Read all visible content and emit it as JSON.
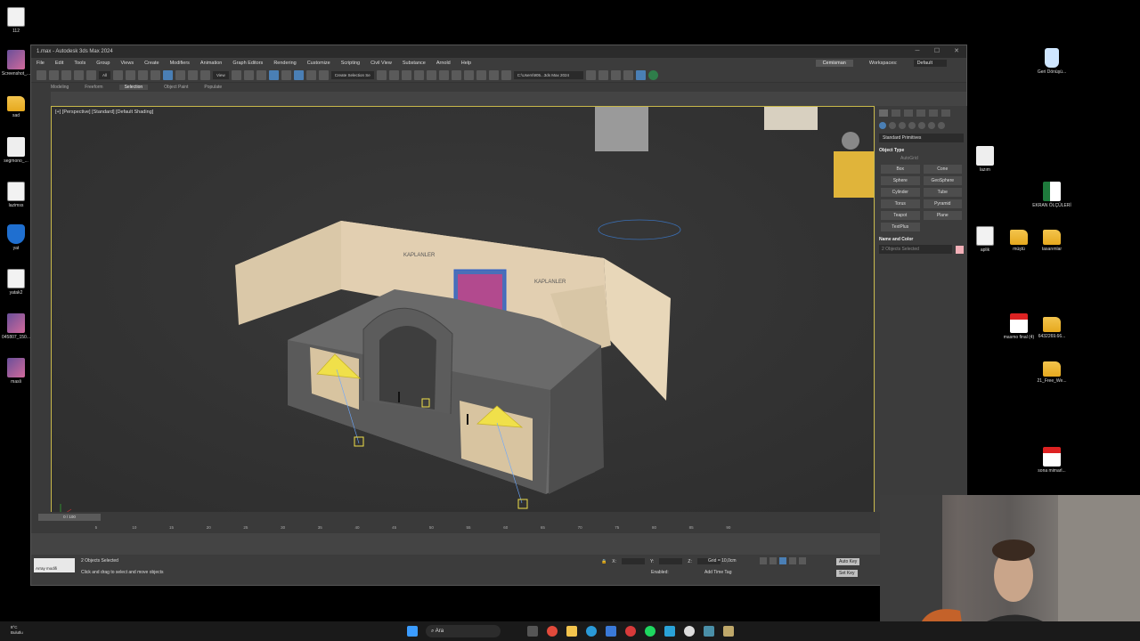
{
  "desktop": {
    "left_icons": [
      {
        "label": "112",
        "kind": "max"
      },
      {
        "label": "Screenshot_...",
        "kind": "img"
      },
      {
        "label": "sad",
        "kind": "folder"
      },
      {
        "label": "segmono_...",
        "kind": "file"
      },
      {
        "label": "lazimss",
        "kind": "max"
      },
      {
        "label": "yat",
        "kind": "shield"
      },
      {
        "label": "yatak2",
        "kind": "max"
      },
      {
        "label": "045807_150...",
        "kind": "img"
      },
      {
        "label": "masli",
        "kind": "img"
      }
    ],
    "right_icons": [
      {
        "label": "Geri Dönüşü...",
        "kind": "trash"
      },
      {
        "label": "lazım",
        "kind": "file"
      },
      {
        "label": "EKRAN ÖLÇÜLERİ",
        "kind": "xls"
      },
      {
        "label": "aplik",
        "kind": "max"
      },
      {
        "label": "müştü",
        "kind": "folder"
      },
      {
        "label": "tasarımlar",
        "kind": "folder"
      },
      {
        "label": "masmo final (4)",
        "kind": "pdf"
      },
      {
        "label": "6432269.66...",
        "kind": "folder"
      },
      {
        "label": "21_Free_We...",
        "kind": "folder"
      },
      {
        "label": "sona mimarl...",
        "kind": "pdf"
      }
    ]
  },
  "window": {
    "title": "1.max - Autodesk 3ds Max 2024",
    "menu": [
      "File",
      "Edit",
      "Tools",
      "Group",
      "Views",
      "Create",
      "Modifiers",
      "Animation",
      "Graph Editors",
      "Rendering",
      "Customize",
      "Scripting",
      "Civil View",
      "Substance",
      "Arnold",
      "Help"
    ],
    "user": "Cemisman",
    "workspaces_label": "Workspaces:",
    "workspace": "Default",
    "toolbar": {
      "filter": "All",
      "view": "View",
      "selection_set": "Create Selection Se",
      "path": "C:\\Users\\905...3ds Max 2024"
    },
    "ribbon": [
      "Modeling",
      "Freeform",
      "Selection",
      "Object Paint",
      "Populate"
    ],
    "ribbon_active": "Selection",
    "viewport_label": "[+] [Perspective] [Standard] [Default Shading]",
    "scene": {
      "sign1": "KAPLANLER",
      "sign2": "KAPLANLER"
    },
    "command_panel": {
      "dropdown": "Standard Primitives",
      "object_type": "Object Type",
      "autogrid": "AutoGrid",
      "buttons": [
        "Box",
        "Cone",
        "Sphere",
        "GeoSphere",
        "Cylinder",
        "Tube",
        "Torus",
        "Pyramid",
        "Teapot",
        "Plane",
        "TextPlus"
      ],
      "name_color": "Name and Color",
      "name_value": "2 Objects Selected",
      "swatch_color": "#f3b0b8"
    },
    "timeline": {
      "slider": "0 / 100",
      "ticks": [
        "5",
        "10",
        "15",
        "20",
        "25",
        "30",
        "35",
        "40",
        "45",
        "50",
        "55",
        "60",
        "65",
        "70",
        "75",
        "80",
        "85",
        "90"
      ]
    },
    "status": {
      "listener": "Array modifi",
      "selected": "2 Objects Selected",
      "hint": "Click and drag to select and move objects",
      "x": "X:",
      "y": "Y:",
      "z": "Z:",
      "grid": "Grid = 10,0cm",
      "enabled": "Enabled:",
      "add_time_tag": "Add Time Tag",
      "auto_key": "Auto Key",
      "selected_btn": "Selected",
      "set_key": "Set Key",
      "frame": "0"
    }
  },
  "taskbar": {
    "search": "Ara",
    "weather_temp": "8°C",
    "weather_text": "Bulutlu"
  }
}
